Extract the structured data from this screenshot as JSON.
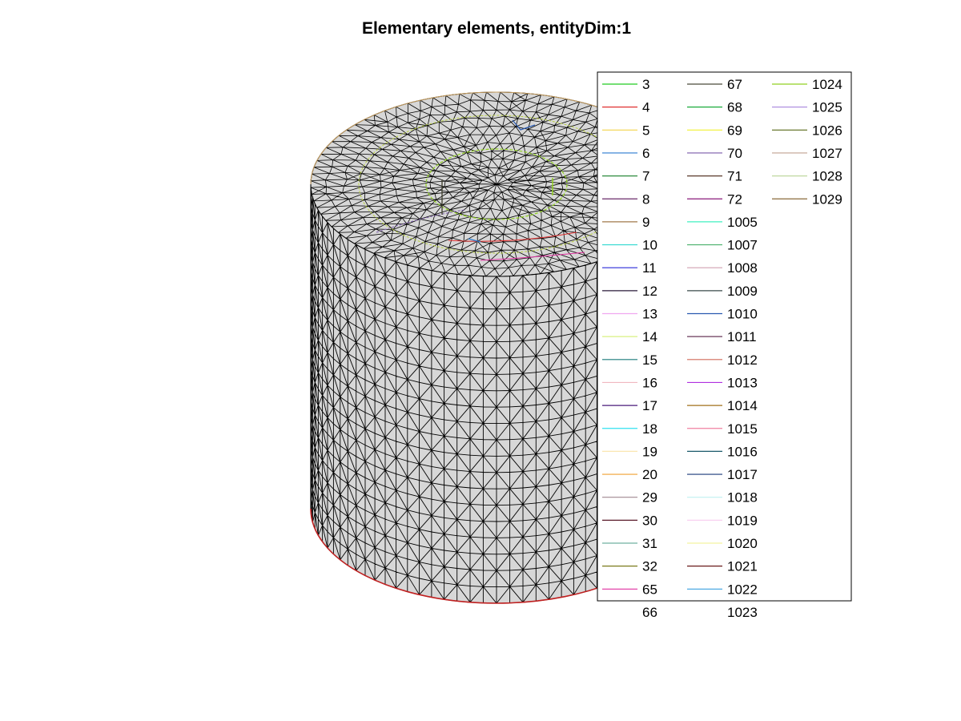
{
  "figure": {
    "title": "Elementary elements, entityDim:1",
    "mesh_fill_color": "#d7d7d7",
    "mesh_edge_color": "#000000"
  },
  "legend": {
    "columns": [
      [
        {
          "label": "3",
          "color": "#22cc22"
        },
        {
          "label": "4",
          "color": "#e03030"
        },
        {
          "label": "5",
          "color": "#f2d34a"
        },
        {
          "label": "6",
          "color": "#2a7bd0"
        },
        {
          "label": "7",
          "color": "#2e8b3e"
        },
        {
          "label": "8",
          "color": "#6a2a6a"
        },
        {
          "label": "9",
          "color": "#a0784a"
        },
        {
          "label": "10",
          "color": "#30d8d0"
        },
        {
          "label": "11",
          "color": "#2a2ad8"
        },
        {
          "label": "12",
          "color": "#2a1a3a"
        },
        {
          "label": "13",
          "color": "#f0a8f0"
        },
        {
          "label": "14",
          "color": "#d8f080"
        },
        {
          "label": "15",
          "color": "#1a7a7a"
        },
        {
          "label": "16",
          "color": "#f0b8c0"
        },
        {
          "label": "17",
          "color": "#4a1a7a"
        },
        {
          "label": "18",
          "color": "#30e0f0"
        },
        {
          "label": "19",
          "color": "#fae6b0"
        },
        {
          "label": "20",
          "color": "#f0a030"
        },
        {
          "label": "29",
          "color": "#a08890"
        },
        {
          "label": "30",
          "color": "#5a1a2a"
        },
        {
          "label": "31",
          "color": "#70b0a0"
        },
        {
          "label": "32",
          "color": "#7a7a1a"
        },
        {
          "label": "65",
          "color": "#e030a0"
        },
        {
          "label": "66",
          "color": "#ffffff"
        }
      ],
      [
        {
          "label": "67",
          "color": "#4a4a3a"
        },
        {
          "label": "68",
          "color": "#1aaa3a"
        },
        {
          "label": "69",
          "color": "#f0f030"
        },
        {
          "label": "70",
          "color": "#7a5aaa"
        },
        {
          "label": "71",
          "color": "#5a3a2a"
        },
        {
          "label": "72",
          "color": "#8a1a7a"
        },
        {
          "label": "1005",
          "color": "#40f0c0"
        },
        {
          "label": "1007",
          "color": "#4ab06a"
        },
        {
          "label": "1008",
          "color": "#d0a0b0"
        },
        {
          "label": "1009",
          "color": "#3a4a4a"
        },
        {
          "label": "1010",
          "color": "#2a5ab0"
        },
        {
          "label": "1011",
          "color": "#6a3a5a"
        },
        {
          "label": "1012",
          "color": "#d06a5a"
        },
        {
          "label": "1013",
          "color": "#b030e0"
        },
        {
          "label": "1014",
          "color": "#a0701a"
        },
        {
          "label": "1015",
          "color": "#f080a0"
        },
        {
          "label": "1016",
          "color": "#1a5a6a"
        },
        {
          "label": "1017",
          "color": "#1a3a7a"
        },
        {
          "label": "1018",
          "color": "#c0f0f0"
        },
        {
          "label": "1019",
          "color": "#f8d0f0"
        },
        {
          "label": "1020",
          "color": "#f4f4a0"
        },
        {
          "label": "1021",
          "color": "#6a1a1a"
        },
        {
          "label": "1022",
          "color": "#3aa0e0"
        },
        {
          "label": "1023",
          "color": "#ffffff"
        }
      ],
      [
        {
          "label": "1024",
          "color": "#90d020"
        },
        {
          "label": "1025",
          "color": "#b090e0"
        },
        {
          "label": "1026",
          "color": "#5a6a1a"
        },
        {
          "label": "1027",
          "color": "#c0a090"
        },
        {
          "label": "1028",
          "color": "#c0d8a0"
        },
        {
          "label": "1029",
          "color": "#8a6a3a"
        }
      ]
    ]
  }
}
